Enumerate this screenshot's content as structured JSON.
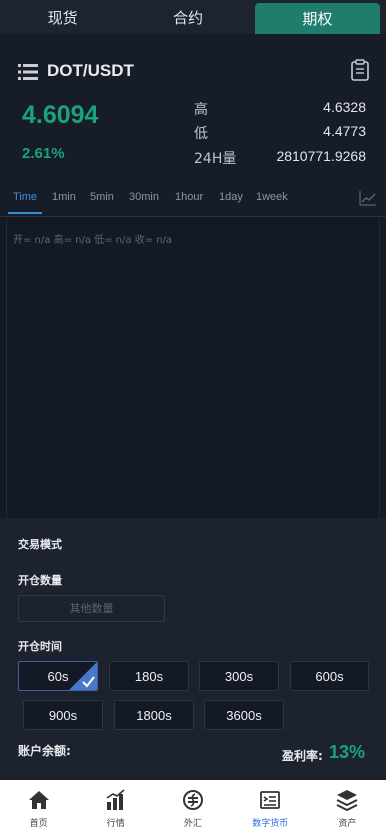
{
  "top_tabs": [
    {
      "label": "现货"
    },
    {
      "label": "合约"
    },
    {
      "label": "期权"
    }
  ],
  "pair": {
    "name": "DOT/USDT",
    "last_price": "4.6094",
    "change_pct": "2.61%",
    "high_label": "高",
    "high_value": "4.6328",
    "low_label": "低",
    "low_value": "4.4773",
    "vol_label": "24H量",
    "vol_value": "2810771.9268"
  },
  "timeframes": [
    "Time",
    "1min",
    "5min",
    "30min",
    "1hour",
    "1day",
    "1week"
  ],
  "active_timeframe": "Time",
  "chart": {
    "ohlc_text": "开= n/a  高= n/a  低= n/a  收= n/a"
  },
  "trade": {
    "mode_title": "交易模式",
    "qty_title": "开仓数量",
    "qty_placeholder": "其他数量",
    "time_title": "开仓时间",
    "durations_row1": [
      "60s",
      "180s",
      "300s",
      "600s"
    ],
    "durations_row2": [
      "900s",
      "1800s",
      "3600s"
    ],
    "selected_duration": "60s",
    "balance_label": "账户余额:",
    "profit_label": "盈利率:",
    "profit_value": "13%"
  },
  "bottom_nav": [
    {
      "label": "首页",
      "icon": "home-icon"
    },
    {
      "label": "行情",
      "icon": "market-icon"
    },
    {
      "label": "外汇",
      "icon": "forex-icon"
    },
    {
      "label": "数字货币",
      "icon": "crypto-icon",
      "active": true
    },
    {
      "label": "资产",
      "icon": "assets-icon"
    }
  ],
  "colors": {
    "accent_green": "#1aa37b",
    "accent_blue": "#3d8fd6",
    "tab_active": "#1f7d6e"
  }
}
